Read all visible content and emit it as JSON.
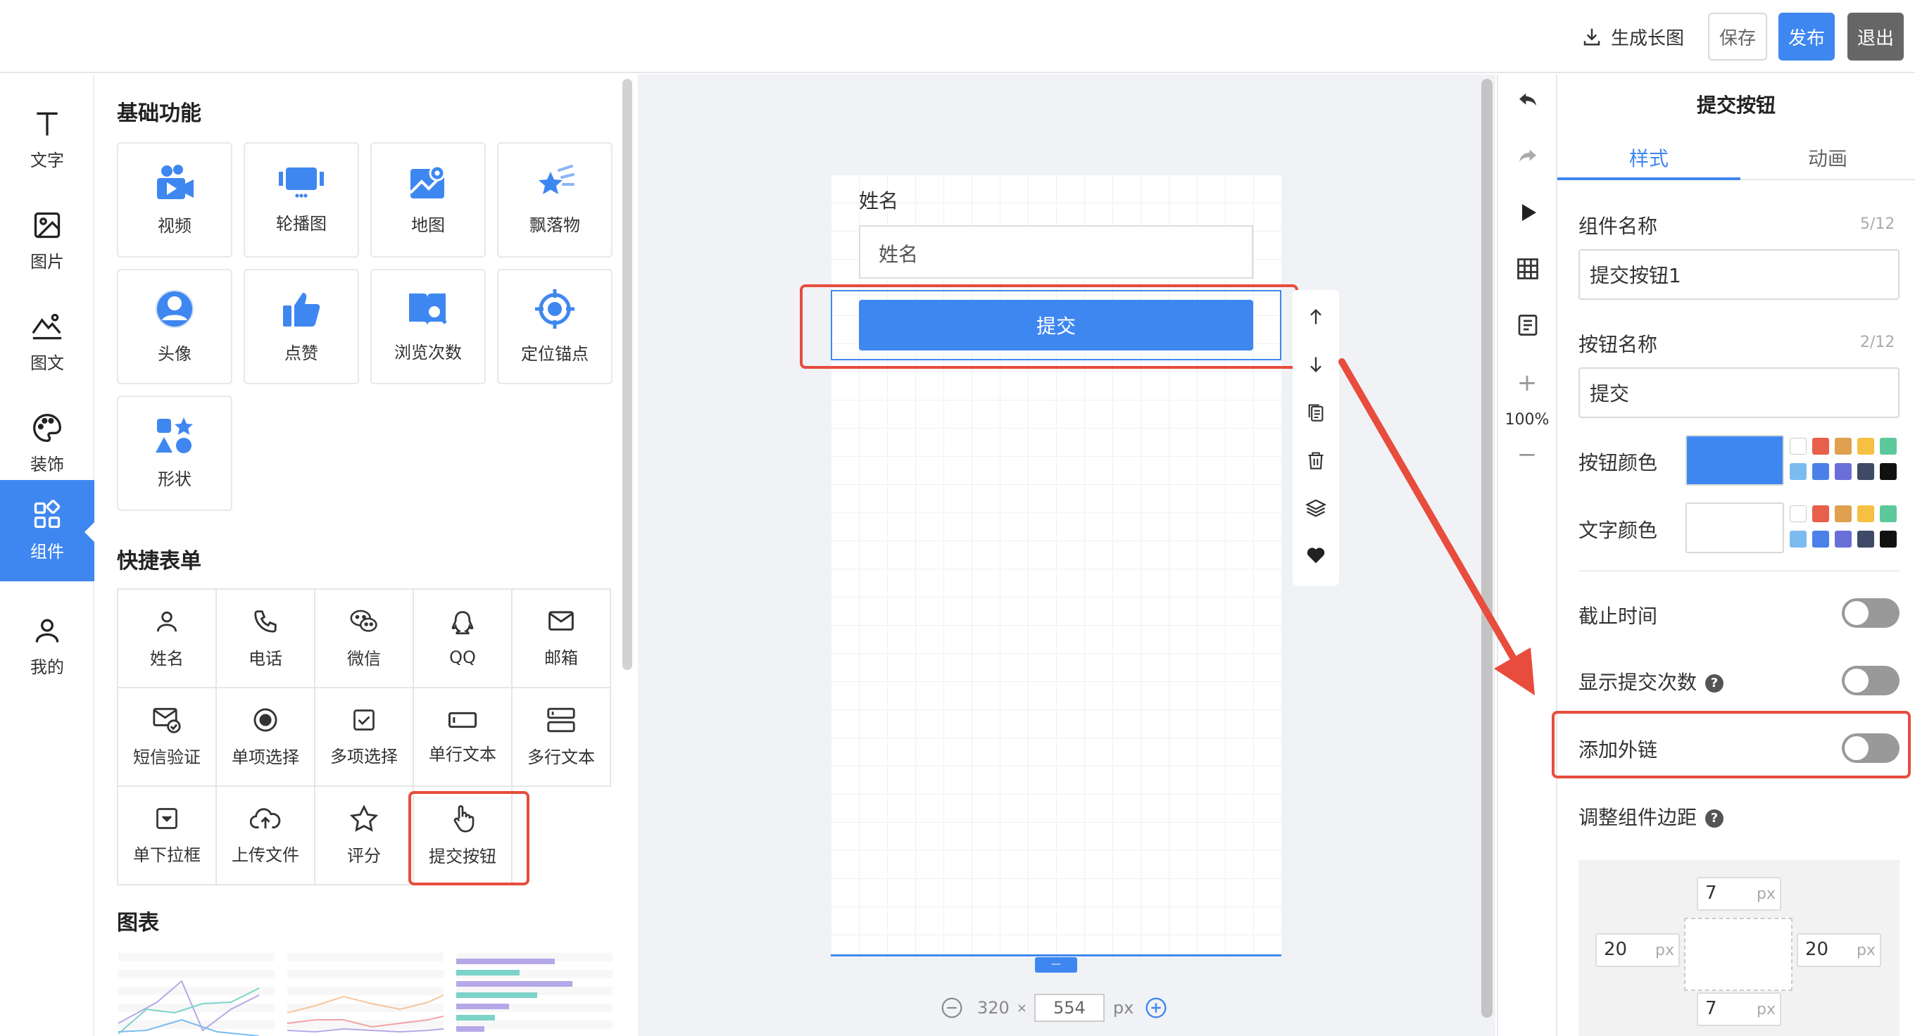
{
  "topbar": {
    "gen_image_label": "生成长图",
    "save_label": "保存",
    "publish_label": "发布",
    "exit_label": "退出"
  },
  "nav": {
    "items": [
      {
        "label": "文字",
        "icon": "text-icon"
      },
      {
        "label": "图片",
        "icon": "image-icon"
      },
      {
        "label": "图文",
        "icon": "image-text-icon"
      },
      {
        "label": "装饰",
        "icon": "palette-icon"
      },
      {
        "label": "组件",
        "icon": "components-icon"
      },
      {
        "label": "我的",
        "icon": "user-icon"
      }
    ],
    "active": "组件"
  },
  "panel": {
    "basic_title": "基础功能",
    "basic_items": [
      "视频",
      "轮播图",
      "地图",
      "飘落物",
      "头像",
      "点赞",
      "浏览次数",
      "定位锚点",
      "形状"
    ],
    "form_title": "快捷表单",
    "form_items": [
      "姓名",
      "电话",
      "微信",
      "QQ",
      "邮箱",
      "短信验证",
      "单项选择",
      "多项选择",
      "单行文本",
      "多行文本",
      "单下拉框",
      "上传文件",
      "评分",
      "提交按钮"
    ],
    "chart_title": "图表"
  },
  "canvas": {
    "field_label": "姓名",
    "field_placeholder": "姓名",
    "submit_label": "提交",
    "width": "320",
    "times": "×",
    "height": "554",
    "unit": "px",
    "handle": "—"
  },
  "controls": {
    "zoom": "100%",
    "plus": "+",
    "minus": "−"
  },
  "props": {
    "title": "提交按钮",
    "tab_style": "样式",
    "tab_anim": "动画",
    "comp_name_label": "组件名称",
    "comp_name_count": "5/12",
    "comp_name_value": "提交按钮1",
    "btn_name_label": "按钮名称",
    "btn_name_count": "2/12",
    "btn_name_value": "提交",
    "btn_color_label": "按钮颜色",
    "text_color_label": "文字颜色",
    "deadline_label": "截止时间",
    "show_count_label": "显示提交次数",
    "add_link_label": "添加外链",
    "margin_label": "调整组件边距",
    "help": "?",
    "margin": {
      "top": "7",
      "left": "20",
      "right": "20",
      "bottom": "7",
      "unit": "px"
    }
  },
  "colors": {
    "accent": "#3f87f0",
    "highlight": "#e74c3c",
    "button_color": "#3f87f0",
    "text_color": "#ffffff",
    "swatches": [
      "#ffffff",
      "#e8604c",
      "#e0a050",
      "#f5c043",
      "#5cc99a",
      "#7cbbf0",
      "#4a80e8",
      "#6a6fd8",
      "#3e4a66",
      "#111111"
    ]
  }
}
